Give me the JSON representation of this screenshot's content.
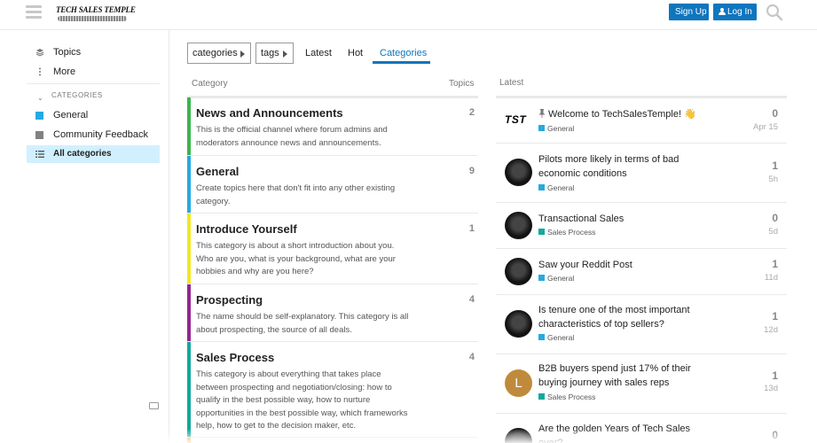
{
  "header": {
    "logo_text": "TECH SALES TEMPLE",
    "signup_label": "Sign Up",
    "login_label": "Log In"
  },
  "sidebar": {
    "items": [
      {
        "label": "Topics",
        "icon": "layers-icon"
      },
      {
        "label": "More",
        "icon": "vertical-ellipsis-icon"
      }
    ],
    "section_label": "CATEGORIES",
    "categories": [
      {
        "label": "General",
        "color": "#25aae1"
      },
      {
        "label": "Community Feedback",
        "color": "#808281"
      }
    ],
    "all_categories_label": "All categories"
  },
  "nav": {
    "categories_dropdown": "categories",
    "tags_dropdown": "tags",
    "tabs": [
      {
        "label": "Latest"
      },
      {
        "label": "Hot"
      },
      {
        "label": "Categories"
      }
    ],
    "active_tab": "Categories"
  },
  "category_table": {
    "headers": {
      "category": "Category",
      "topics": "Topics"
    },
    "rows": [
      {
        "name": "News and Announcements",
        "description": "This is the official channel where forum admins and moderators announce news and announcements.",
        "topics": "2",
        "color": "#3ab54a"
      },
      {
        "name": "General",
        "description": "Create topics here that don't fit into any other existing category.",
        "topics": "9",
        "color": "#25aae1"
      },
      {
        "name": "Introduce Yourself",
        "description": "This category is about a short introduction about you. Who are you, what is your background, what are your hobbies and why are you here?",
        "topics": "1",
        "color": "#f1e722"
      },
      {
        "name": "Prospecting",
        "description": "The name should be self-explanatory. This category is all about prospecting, the source of all deals.",
        "topics": "4",
        "color": "#92278f"
      },
      {
        "name": "Sales Process",
        "description": "This category is about everything that takes place between prospecting and negotiation/closing: how to qualify in the best possible way, how to nurture opportunities in the best possible way, which frameworks help, how to get to the decision maker, etc.",
        "topics": "4",
        "color": "#12a89d"
      }
    ]
  },
  "latest": {
    "header": "Latest",
    "topics": [
      {
        "title": "Welcome to TechSalesTemple! 👋",
        "category": "General",
        "category_color": "#25aae1",
        "count": "0",
        "age": "Apr 15",
        "pinned": true,
        "avatar": "TST"
      },
      {
        "title": "Pilots more likely in terms of bad economic conditions",
        "category": "General",
        "category_color": "#25aae1",
        "count": "1",
        "age": "5h",
        "pinned": false,
        "avatar": ""
      },
      {
        "title": "Transactional Sales",
        "category": "Sales Process",
        "category_color": "#12a89d",
        "count": "0",
        "age": "5d",
        "pinned": false,
        "avatar": ""
      },
      {
        "title": "Saw your Reddit Post",
        "category": "General",
        "category_color": "#25aae1",
        "count": "1",
        "age": "11d",
        "pinned": false,
        "avatar": ""
      },
      {
        "title": "Is tenure one of the most important characteristics of top sellers?",
        "category": "General",
        "category_color": "#25aae1",
        "count": "1",
        "age": "12d",
        "pinned": false,
        "avatar": ""
      },
      {
        "title": "B2B buyers spend just 17% of their buying journey with sales reps",
        "category": "Sales Process",
        "category_color": "#12a89d",
        "count": "1",
        "age": "13d",
        "pinned": false,
        "avatar": "L"
      },
      {
        "title": "Are the golden Years of Tech Sales over?",
        "category": "",
        "category_color": "#25aae1",
        "count": "0",
        "age": "",
        "pinned": false,
        "avatar": ""
      }
    ]
  }
}
